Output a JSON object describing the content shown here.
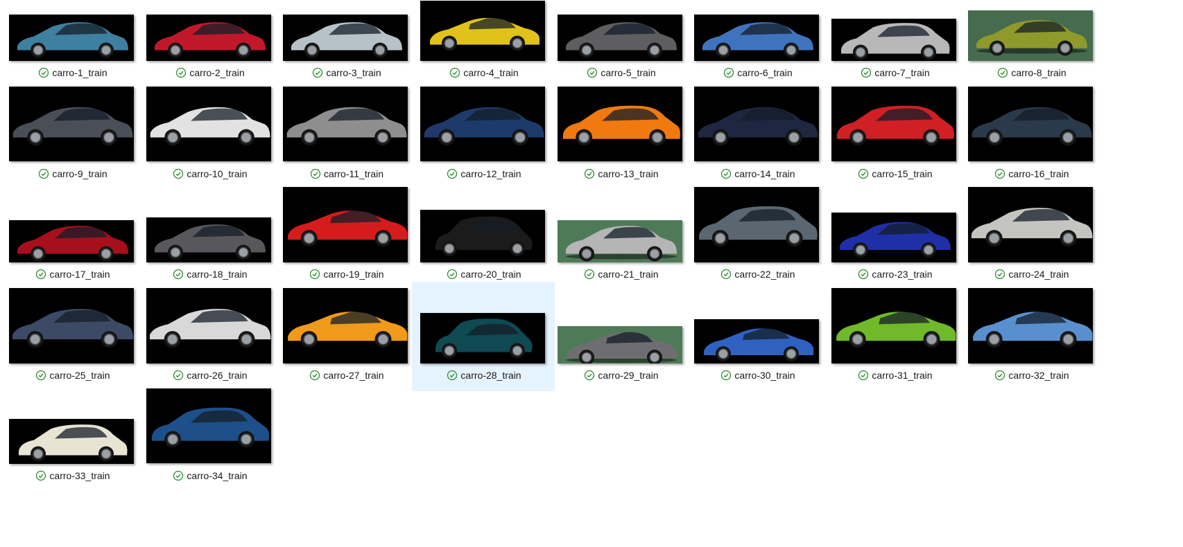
{
  "files": [
    {
      "name": "carro-1_train",
      "status_icon": "check-circle-icon",
      "car_color": "#3f7fa0",
      "bg": "#000000",
      "body": "sedan"
    },
    {
      "name": "carro-2_train",
      "status_icon": "check-circle-icon",
      "car_color": "#c0182a",
      "bg": "#000000",
      "body": "sedan"
    },
    {
      "name": "carro-3_train",
      "status_icon": "check-circle-icon",
      "car_color": "#b7c2c8",
      "bg": "#000000",
      "body": "sedan"
    },
    {
      "name": "carro-4_train",
      "status_icon": "check-circle-icon",
      "car_color": "#e0c21a",
      "bg": "#000000",
      "body": "coupe"
    },
    {
      "name": "carro-5_train",
      "status_icon": "check-circle-icon",
      "car_color": "#5e5e60",
      "bg": "#000000",
      "body": "sedan"
    },
    {
      "name": "carro-6_train",
      "status_icon": "check-circle-icon",
      "car_color": "#3f73bd",
      "bg": "#000000",
      "body": "sedan"
    },
    {
      "name": "carro-7_train",
      "status_icon": "check-circle-icon",
      "car_color": "#b8b8b8",
      "bg": "#000000",
      "body": "hatch"
    },
    {
      "name": "carro-8_train",
      "status_icon": "check-circle-icon",
      "car_color": "#8f9a2a",
      "bg": "#466b4e",
      "body": "sedan"
    },
    {
      "name": "carro-9_train",
      "status_icon": "check-circle-icon",
      "car_color": "#4a4f57",
      "bg": "#000000",
      "body": "sedan"
    },
    {
      "name": "carro-10_train",
      "status_icon": "check-circle-icon",
      "car_color": "#e2e2e2",
      "bg": "#000000",
      "body": "sedan"
    },
    {
      "name": "carro-11_train",
      "status_icon": "check-circle-icon",
      "car_color": "#8e8e8e",
      "bg": "#000000",
      "body": "sedan"
    },
    {
      "name": "carro-12_train",
      "status_icon": "check-circle-icon",
      "car_color": "#1d3a6b",
      "bg": "#000000",
      "body": "sedan"
    },
    {
      "name": "carro-13_train",
      "status_icon": "check-circle-icon",
      "car_color": "#f07a10",
      "bg": "#000000",
      "body": "hatch"
    },
    {
      "name": "carro-14_train",
      "status_icon": "check-circle-icon",
      "car_color": "#1e2640",
      "bg": "#000000",
      "body": "sedan"
    },
    {
      "name": "carro-15_train",
      "status_icon": "check-circle-icon",
      "car_color": "#d01f25",
      "bg": "#000000",
      "body": "hatch"
    },
    {
      "name": "carro-16_train",
      "status_icon": "check-circle-icon",
      "car_color": "#2a3a4a",
      "bg": "#000000",
      "body": "sedan"
    },
    {
      "name": "carro-17_train",
      "status_icon": "check-circle-icon",
      "car_color": "#a80f1c",
      "bg": "#000000",
      "body": "sedan"
    },
    {
      "name": "carro-18_train",
      "status_icon": "check-circle-icon",
      "car_color": "#58585c",
      "bg": "#000000",
      "body": "sedan"
    },
    {
      "name": "carro-19_train",
      "status_icon": "check-circle-icon",
      "car_color": "#d41c1c",
      "bg": "#000000",
      "body": "coupe"
    },
    {
      "name": "carro-20_train",
      "status_icon": "check-circle-icon",
      "car_color": "#1b1b1b",
      "bg": "#000000",
      "body": "small"
    },
    {
      "name": "carro-21_train",
      "status_icon": "check-circle-icon",
      "car_color": "#b5b5b5",
      "bg": "#4f7a58",
      "body": "sedan"
    },
    {
      "name": "carro-22_train",
      "status_icon": "check-circle-icon",
      "car_color": "#5a6670",
      "bg": "#000000",
      "body": "hatch"
    },
    {
      "name": "carro-23_train",
      "status_icon": "check-circle-icon",
      "car_color": "#1f2fa8",
      "bg": "#000000",
      "body": "sedan"
    },
    {
      "name": "carro-24_train",
      "status_icon": "check-circle-icon",
      "car_color": "#c4c4c0",
      "bg": "#000000",
      "body": "sedan"
    },
    {
      "name": "carro-25_train",
      "status_icon": "check-circle-icon",
      "car_color": "#3d4a66",
      "bg": "#000000",
      "body": "sedan"
    },
    {
      "name": "carro-26_train",
      "status_icon": "check-circle-icon",
      "car_color": "#d8d8d8",
      "bg": "#000000",
      "body": "sedan"
    },
    {
      "name": "carro-27_train",
      "status_icon": "check-circle-icon",
      "car_color": "#ef9a1a",
      "bg": "#000000",
      "body": "coupe"
    },
    {
      "name": "carro-28_train",
      "status_icon": "check-circle-icon",
      "car_color": "#0f4a52",
      "bg": "#000000",
      "body": "small"
    },
    {
      "name": "carro-29_train",
      "status_icon": "check-circle-icon",
      "car_color": "#6e6e70",
      "bg": "#4f7a58",
      "body": "coupe"
    },
    {
      "name": "carro-30_train",
      "status_icon": "check-circle-icon",
      "car_color": "#2f62c0",
      "bg": "#000000",
      "body": "coupe"
    },
    {
      "name": "carro-31_train",
      "status_icon": "check-circle-icon",
      "car_color": "#6fb92a",
      "bg": "#000000",
      "body": "coupe"
    },
    {
      "name": "carro-32_train",
      "status_icon": "check-circle-icon",
      "car_color": "#5a8fcf",
      "bg": "#000000",
      "body": "coupe"
    },
    {
      "name": "carro-33_train",
      "status_icon": "check-circle-icon",
      "car_color": "#e8e4d4",
      "bg": "#000000",
      "body": "hatch"
    },
    {
      "name": "carro-34_train",
      "status_icon": "check-circle-icon",
      "car_color": "#1d4f8a",
      "bg": "#000000",
      "body": "hatch"
    }
  ],
  "selected_file": "carro-28_train",
  "colors": {
    "check": "#2e8b2e",
    "selection": "#e5f3ff"
  }
}
